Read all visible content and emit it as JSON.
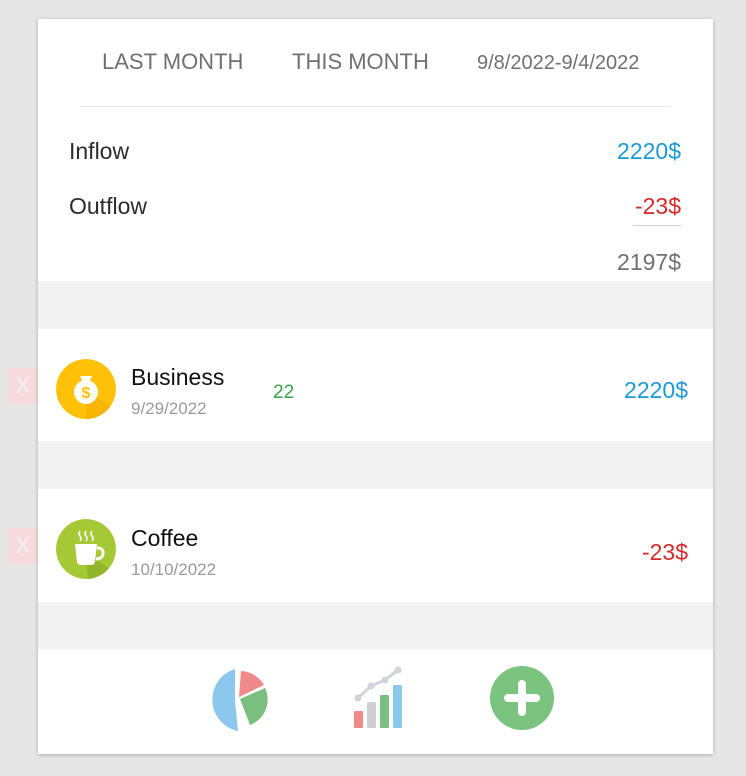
{
  "header": {
    "tab_last_month": "LAST MONTH",
    "tab_this_month": "THIS MONTH",
    "date_range": "9/8/2022-9/4/2022"
  },
  "summary": {
    "inflow_label": "Inflow",
    "inflow_value": "2220$",
    "outflow_label": "Outflow",
    "outflow_value": "-23$",
    "balance_value": "2197$"
  },
  "transactions": [
    {
      "name": "Business",
      "date": "9/29/2022",
      "note": "22",
      "amount": "2220$",
      "icon": "money-bag-icon",
      "icon_color": "#ffc107",
      "amount_color": "#1a9ad6"
    },
    {
      "name": "Coffee",
      "date": "10/10/2022",
      "note": "",
      "amount": "-23$",
      "icon": "coffee-cup-icon",
      "icon_color": "#a4c934",
      "amount_color": "#d62828"
    }
  ],
  "delete_label": "X",
  "colors": {
    "inflow": "#1a9ad6",
    "outflow": "#d62828",
    "balance": "#707070",
    "add_button": "#7bc47f"
  },
  "bottom_nav": [
    "pie-chart-icon",
    "bar-chart-icon",
    "add-icon"
  ]
}
